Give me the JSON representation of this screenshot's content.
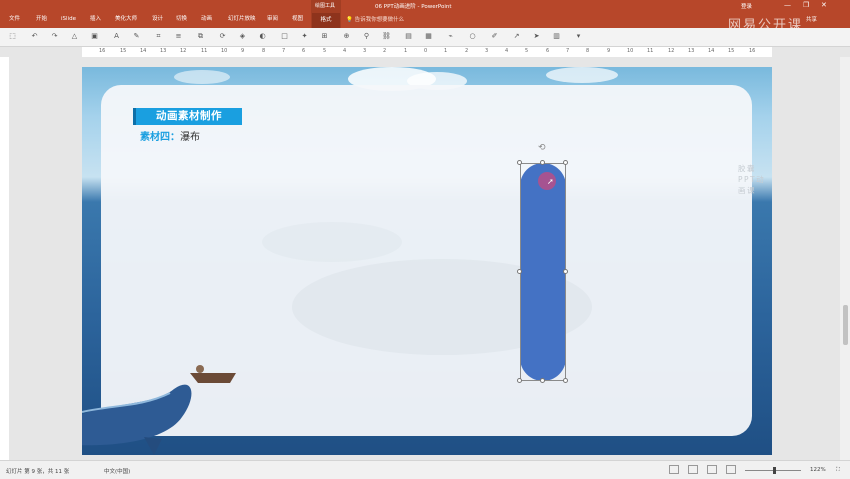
{
  "titlebar": {
    "tabs": [
      "文件",
      "开始",
      "iSlide",
      "插入",
      "美化大师",
      "设计",
      "切换",
      "动画",
      "幻灯片放映",
      "审阅",
      "视图",
      "格式"
    ],
    "context_header": "绘图工具",
    "doc_title": "06 PPT动画进阶 - PowerPoint",
    "tell_me": "告诉我你想要做什么",
    "login": "登录",
    "share": "共享",
    "window_buttons": [
      "—",
      "❐",
      "✕"
    ]
  },
  "toolbar_icons": [
    "select-icon",
    "undo-icon",
    "redo-icon",
    "shapes-icon",
    "text-icon",
    "save-icon",
    "format-painter-icon",
    "crop-icon",
    "align-icon",
    "group-icon",
    "rotate-icon",
    "arrange-icon",
    "fill-icon",
    "outline-icon",
    "effects-icon",
    "size-icon",
    "zoom-icon",
    "pin-icon",
    "link-icon",
    "chart-icon",
    "table-icon",
    "more-icon"
  ],
  "ruler": {
    "ticks": [
      "16",
      "15",
      "14",
      "13",
      "12",
      "11",
      "10",
      "9",
      "8",
      "7",
      "6",
      "5",
      "4",
      "3",
      "2",
      "1",
      "0",
      "1",
      "2",
      "3",
      "4",
      "5",
      "6",
      "7",
      "8",
      "9",
      "10",
      "11",
      "12",
      "13",
      "14",
      "15",
      "16"
    ]
  },
  "slide": {
    "banner_title": "动画素材制作",
    "material_prefix": "素材四：",
    "material_name": "瀑布",
    "brand_watermark": "胶囊PPT动画课",
    "shape_color": "#4472c4",
    "accent_color": "#1a9fe0"
  },
  "watermark": "网易公开课",
  "statusbar": {
    "slide_info": "幻灯片 第 9 张，共 11 张",
    "language": "中文(中国)",
    "zoom": "122%",
    "zoom_level": 0.5
  },
  "colors": {
    "titlebar": "#b7472a",
    "format_tab": "#8e331c"
  }
}
